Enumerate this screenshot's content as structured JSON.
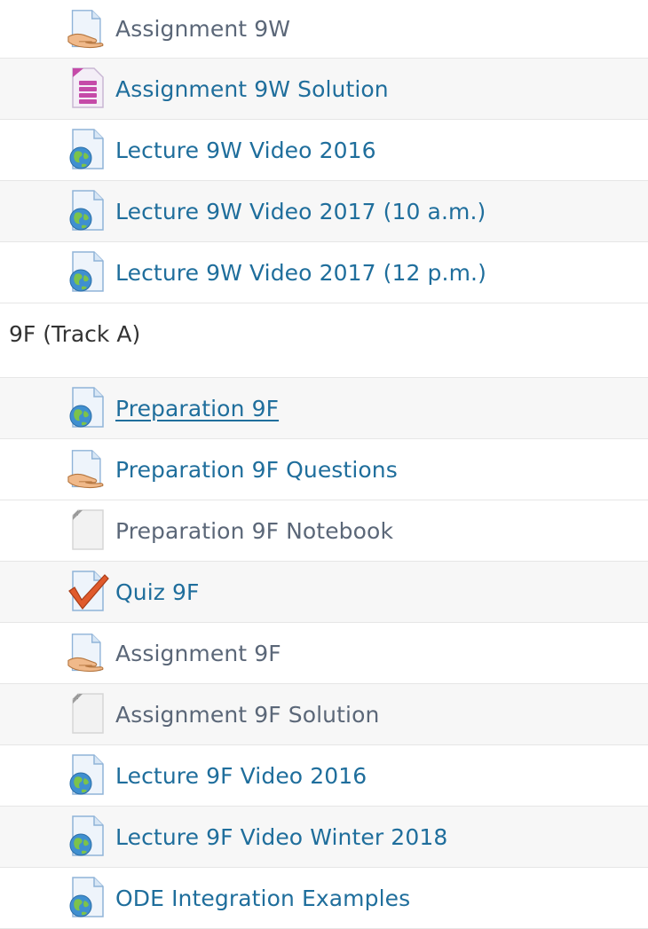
{
  "items_top": [
    {
      "label": "Assignment 9W",
      "icon": "assignment-icon",
      "style": "muted"
    },
    {
      "label": "Assignment 9W Solution",
      "icon": "file-icon",
      "style": "link"
    },
    {
      "label": "Lecture 9W Video 2016",
      "icon": "url-icon",
      "style": "link"
    },
    {
      "label": "Lecture 9W Video 2017 (10 a.m.)",
      "icon": "url-icon",
      "style": "link"
    },
    {
      "label": "Lecture 9W Video 2017 (12 p.m.)",
      "icon": "url-icon",
      "style": "link"
    }
  ],
  "section": {
    "title": "9F (Track A)"
  },
  "items_bottom": [
    {
      "label": "Preparation 9F",
      "icon": "url-icon",
      "style": "link-underline"
    },
    {
      "label": "Preparation 9F Questions",
      "icon": "assignment-icon",
      "style": "link"
    },
    {
      "label": "Preparation 9F Notebook",
      "icon": "blank-file-icon",
      "style": "muted"
    },
    {
      "label": "Quiz 9F",
      "icon": "quiz-icon",
      "style": "link"
    },
    {
      "label": "Assignment 9F",
      "icon": "assignment-icon",
      "style": "muted"
    },
    {
      "label": "Assignment 9F Solution",
      "icon": "blank-file-icon",
      "style": "muted"
    },
    {
      "label": "Lecture 9F Video 2016",
      "icon": "url-icon",
      "style": "link"
    },
    {
      "label": "Lecture 9F Video Winter 2018",
      "icon": "url-icon",
      "style": "link"
    },
    {
      "label": "ODE Integration Examples",
      "icon": "url-icon",
      "style": "link"
    }
  ],
  "colors": {
    "link": "#1f6e9c",
    "muted": "#5b6778",
    "row_alt": "#f7f7f7"
  }
}
